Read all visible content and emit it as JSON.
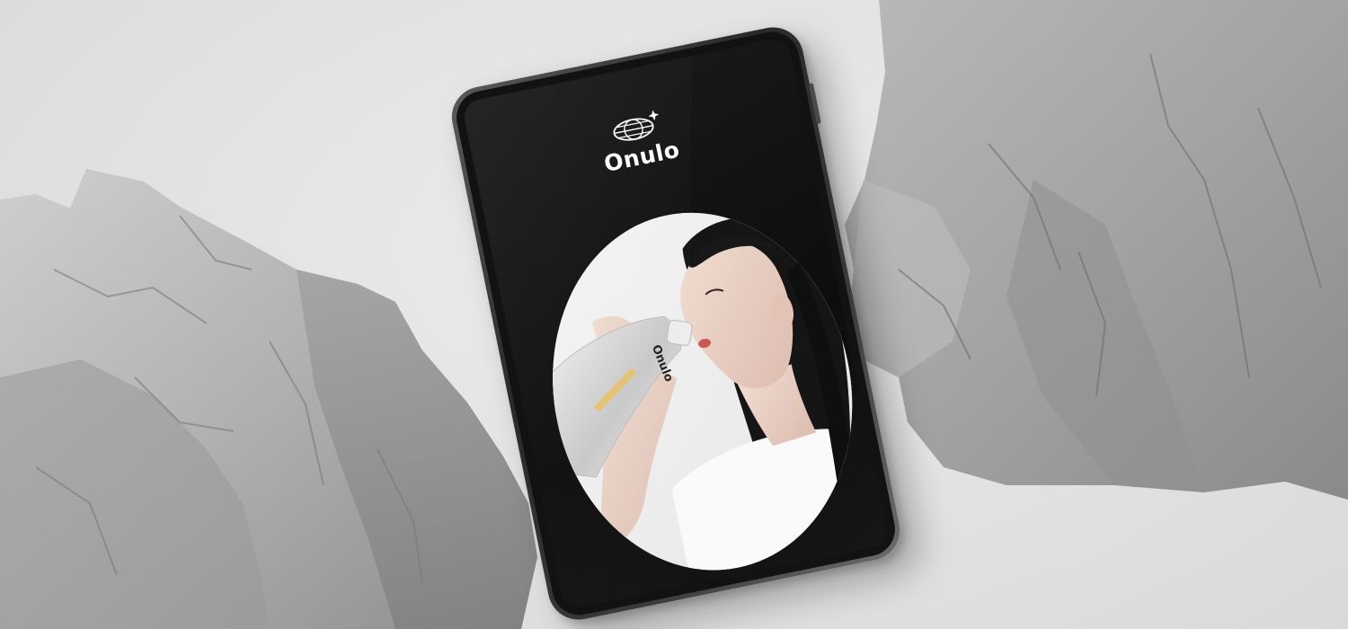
{
  "scene": {
    "background_color": "#e4e4e4",
    "rock_color": "#a9a9a9",
    "objects": [
      "rock-left",
      "rock-right",
      "tablet"
    ]
  },
  "tablet": {
    "brand_name": "Onulo",
    "logo_icon": "globe-with-sparkle-icon",
    "screen_color": "#111111",
    "photo": {
      "subject": "woman-drinking-from-pouch",
      "shape": "oval"
    },
    "pouch_label": "Onulo"
  }
}
